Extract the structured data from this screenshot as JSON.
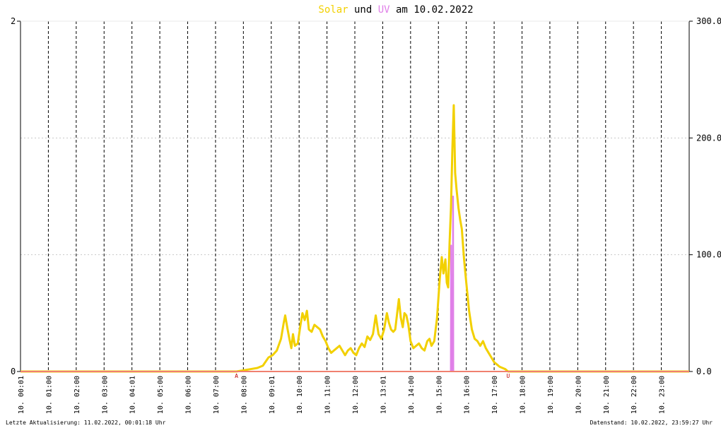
{
  "chart_data": {
    "type": "line",
    "title": {
      "part1": "Solar",
      "part2": " und ",
      "part3": "UV",
      "part4": " am 10.02.2022"
    },
    "colors": {
      "solar": "#f2d000",
      "uv": "#e080e8",
      "title_text": "#000000",
      "sun_marker": "#c00000",
      "baseline": "#f08070"
    },
    "left_axis": {
      "ylim": [
        0,
        2
      ],
      "ticks": [
        "0",
        "2"
      ]
    },
    "right_axis": {
      "ylim": [
        0,
        300
      ],
      "ticks": [
        "0.0",
        "100.0",
        "200.0",
        "300.0"
      ]
    },
    "x_tick_labels": [
      "10. 00:01",
      "10. 01:00",
      "10. 02:00",
      "10. 03:00",
      "10. 04:01",
      "10. 05:00",
      "10. 06:00",
      "10. 07:00",
      "10. 08:00",
      "10. 09:01",
      "10. 10:00",
      "10. 11:00",
      "10. 12:00",
      "10. 13:01",
      "10. 14:00",
      "10. 15:00",
      "10. 16:00",
      "10. 17:00",
      "10. 18:00",
      "10. 19:00",
      "10. 20:00",
      "10. 21:00",
      "10. 22:00",
      "10. 23:00"
    ],
    "sun_markers": {
      "sunrise_label": "A",
      "sunrise_hour": 7.75,
      "sunset_label": "U",
      "sunset_hour": 17.5
    },
    "series": [
      {
        "name": "Solar",
        "axis": "right",
        "points": [
          [
            0,
            0
          ],
          [
            7.75,
            0
          ],
          [
            8.0,
            1
          ],
          [
            8.25,
            2
          ],
          [
            8.5,
            3
          ],
          [
            8.7,
            5
          ],
          [
            8.9,
            12
          ],
          [
            9.05,
            14
          ],
          [
            9.2,
            18
          ],
          [
            9.35,
            28
          ],
          [
            9.45,
            42
          ],
          [
            9.5,
            48
          ],
          [
            9.58,
            37
          ],
          [
            9.65,
            28
          ],
          [
            9.72,
            20
          ],
          [
            9.78,
            32
          ],
          [
            9.85,
            22
          ],
          [
            9.95,
            24
          ],
          [
            10.05,
            40
          ],
          [
            10.12,
            50
          ],
          [
            10.2,
            44
          ],
          [
            10.28,
            52
          ],
          [
            10.35,
            36
          ],
          [
            10.45,
            34
          ],
          [
            10.55,
            40
          ],
          [
            10.65,
            38
          ],
          [
            10.75,
            36
          ],
          [
            10.85,
            30
          ],
          [
            10.95,
            26
          ],
          [
            11.05,
            20
          ],
          [
            11.15,
            16
          ],
          [
            11.25,
            18
          ],
          [
            11.35,
            20
          ],
          [
            11.45,
            22
          ],
          [
            11.55,
            18
          ],
          [
            11.65,
            14
          ],
          [
            11.75,
            18
          ],
          [
            11.85,
            20
          ],
          [
            11.95,
            16
          ],
          [
            12.05,
            14
          ],
          [
            12.15,
            20
          ],
          [
            12.25,
            24
          ],
          [
            12.35,
            21
          ],
          [
            12.45,
            30
          ],
          [
            12.55,
            27
          ],
          [
            12.65,
            32
          ],
          [
            12.75,
            48
          ],
          [
            12.85,
            32
          ],
          [
            12.95,
            28
          ],
          [
            13.05,
            36
          ],
          [
            13.15,
            50
          ],
          [
            13.22,
            42
          ],
          [
            13.3,
            36
          ],
          [
            13.38,
            34
          ],
          [
            13.45,
            36
          ],
          [
            13.52,
            50
          ],
          [
            13.58,
            62
          ],
          [
            13.65,
            46
          ],
          [
            13.72,
            38
          ],
          [
            13.78,
            50
          ],
          [
            13.85,
            48
          ],
          [
            13.92,
            40
          ],
          [
            14.0,
            26
          ],
          [
            14.1,
            20
          ],
          [
            14.2,
            22
          ],
          [
            14.3,
            24
          ],
          [
            14.4,
            20
          ],
          [
            14.5,
            18
          ],
          [
            14.6,
            26
          ],
          [
            14.68,
            28
          ],
          [
            14.75,
            22
          ],
          [
            14.85,
            26
          ],
          [
            14.95,
            46
          ],
          [
            15.05,
            80
          ],
          [
            15.12,
            98
          ],
          [
            15.18,
            84
          ],
          [
            15.25,
            96
          ],
          [
            15.3,
            76
          ],
          [
            15.35,
            72
          ],
          [
            15.4,
            110
          ],
          [
            15.45,
            140
          ],
          [
            15.5,
            190
          ],
          [
            15.55,
            228
          ],
          [
            15.6,
            170
          ],
          [
            15.65,
            156
          ],
          [
            15.72,
            140
          ],
          [
            15.78,
            130
          ],
          [
            15.84,
            122
          ],
          [
            15.92,
            96
          ],
          [
            16.0,
            76
          ],
          [
            16.1,
            52
          ],
          [
            16.2,
            36
          ],
          [
            16.3,
            28
          ],
          [
            16.4,
            26
          ],
          [
            16.5,
            22
          ],
          [
            16.6,
            26
          ],
          [
            16.7,
            20
          ],
          [
            16.8,
            16
          ],
          [
            16.9,
            12
          ],
          [
            17.0,
            8
          ],
          [
            17.1,
            6
          ],
          [
            17.2,
            4
          ],
          [
            17.3,
            3
          ],
          [
            17.4,
            2
          ],
          [
            17.5,
            0
          ],
          [
            24,
            0
          ]
        ]
      },
      {
        "name": "UV",
        "axis": "left",
        "points": [
          [
            0,
            0
          ],
          [
            15.44,
            0
          ],
          [
            15.45,
            0.72
          ],
          [
            15.46,
            0.72
          ],
          [
            15.47,
            0
          ],
          [
            15.51,
            0
          ],
          [
            15.52,
            1.0
          ],
          [
            15.53,
            1.0
          ],
          [
            15.54,
            0
          ],
          [
            24,
            0
          ]
        ]
      }
    ],
    "footer": {
      "left": "Letzte Aktualisierung: 11.02.2022, 00:01:18 Uhr",
      "right": "Datenstand: 10.02.2022, 23:59:27 Uhr"
    }
  }
}
